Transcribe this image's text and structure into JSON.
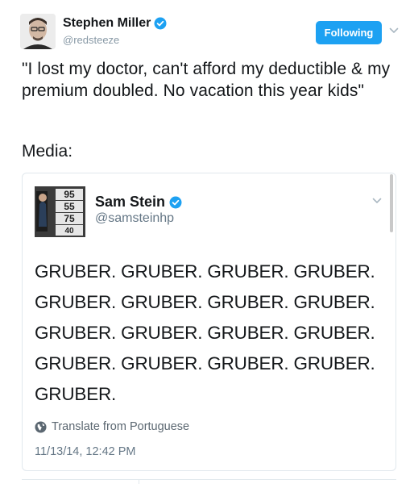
{
  "tweet": {
    "author": {
      "name": "Stephen Miller",
      "handle": "@redsteeze",
      "verified": true
    },
    "follow_button": "Following",
    "text": "\"I lost my doctor, can't afford my deductible & my premium doubled. No vacation this year kids\"",
    "media_label": "Media:"
  },
  "embedded": {
    "author": {
      "name": "Sam Stein",
      "handle": "@samsteinhp",
      "verified": true
    },
    "avatar_numbers": [
      "95",
      "55",
      "75",
      "40"
    ],
    "text": "GRUBER. GRUBER. GRUBER. GRUBER. GRUBER. GRUBER. GRUBER. GRUBER. GRUBER. GRUBER. GRUBER. GRUBER. GRUBER. GRUBER. GRUBER. GRUBER. GRUBER.",
    "translate_label": "Translate from Portuguese",
    "timestamp": "11/13/14, 12:42 PM"
  },
  "icons": {
    "verified": "verified-badge-icon",
    "caret": "chevron-down-icon",
    "globe": "globe-icon"
  },
  "colors": {
    "accent": "#1da1f2",
    "text": "#14171a",
    "secondary": "#657786",
    "border": "#e1e8ed"
  }
}
